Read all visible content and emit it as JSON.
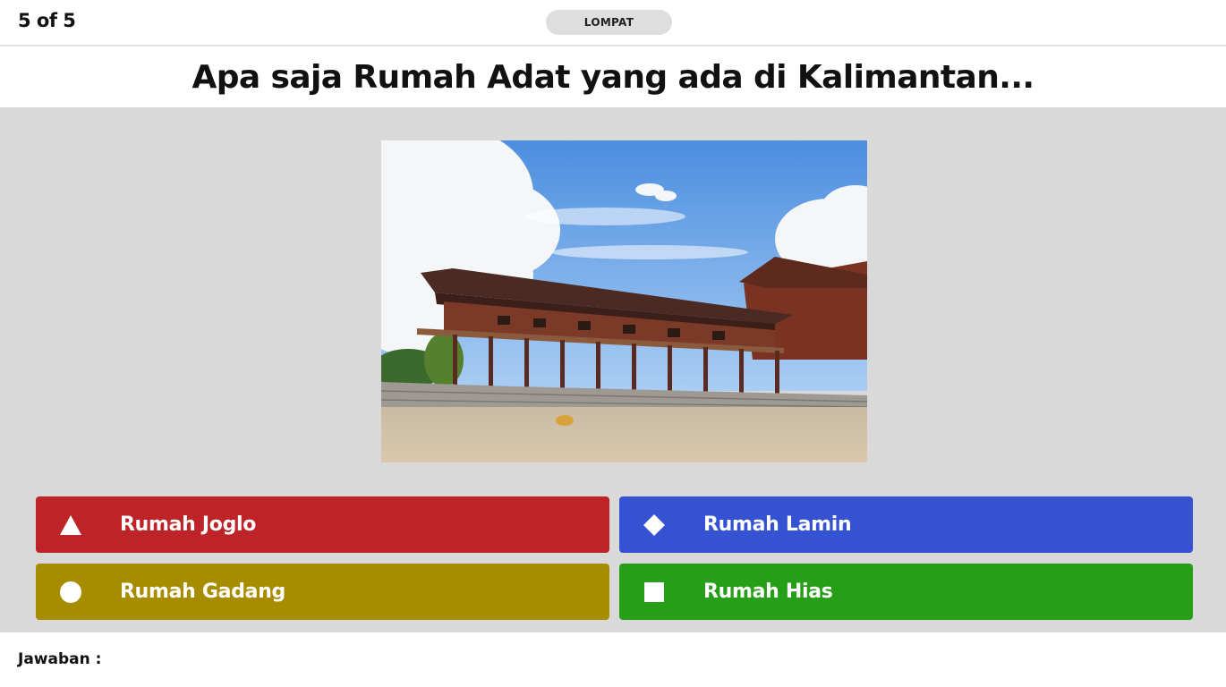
{
  "header": {
    "progress": "5 of 5",
    "skip_label": "LOMPAT"
  },
  "question": {
    "text": "Apa saja Rumah Adat yang ada di Kalimantan..."
  },
  "answers": [
    {
      "label": "Rumah Joglo",
      "shape": "triangle-icon",
      "color": "#bd2327"
    },
    {
      "label": "Rumah Lamin",
      "shape": "diamond-icon",
      "color": "#3552d3"
    },
    {
      "label": "Rumah Gadang",
      "shape": "circle-icon",
      "color": "#a88c00"
    },
    {
      "label": "Rumah Hias",
      "shape": "square-icon",
      "color": "#279e18"
    }
  ],
  "footer": {
    "answer_label": "Jawaban :"
  },
  "colors": {
    "stage_background": "#d9d9d9",
    "skip_button": "#dedede",
    "text": "#111111"
  }
}
